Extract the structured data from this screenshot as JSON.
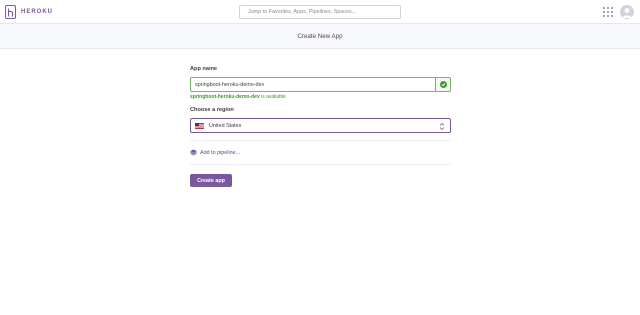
{
  "header": {
    "brand": "HEROKU",
    "search_placeholder": "Jump to Favorites, Apps, Pipelines, Spaces..."
  },
  "subheader": {
    "title": "Create New App"
  },
  "form": {
    "app_name_label": "App name",
    "app_name_value": "springboot-heroku-demo-dev",
    "availability_name": "springboot-heroku-demo-dev",
    "availability_text": " is available",
    "region_label": "Choose a region",
    "region_value": "United States",
    "pipeline_link": "Add to pipeline...",
    "create_button": "Create app"
  },
  "icons": {
    "logo": "heroku-logo-icon",
    "apps": "apps-grid-icon",
    "avatar": "user-avatar-icon",
    "valid": "check-circle-icon",
    "flag": "us-flag-icon",
    "select": "sort-arrows-icon",
    "pipeline": "pipeline-icon"
  },
  "colors": {
    "accent": "#79589f",
    "success": "#3d9a2f",
    "subheader_bg": "#f7f8fb"
  }
}
